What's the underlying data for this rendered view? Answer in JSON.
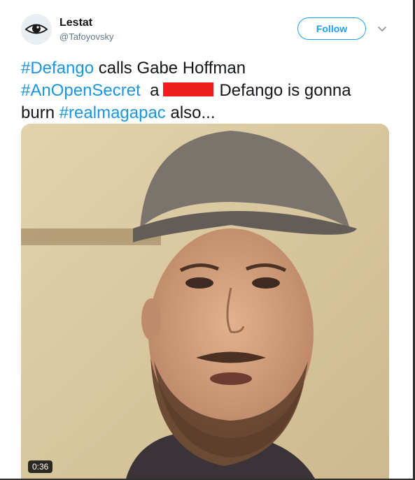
{
  "user": {
    "display_name": "Lestat",
    "handle": "@Tafoyovsky",
    "avatar_icon": "eye-icon"
  },
  "actions": {
    "follow_label": "Follow",
    "more_icon": "chevron-down-icon"
  },
  "tweet": {
    "hashtag_1": "#Defango",
    "text_1": " calls Gabe Hoffman",
    "hashtag_2": "#AnOpenSecret",
    "text_2a": "  a",
    "text_2b": "Defango is gonna",
    "text_3a": "burn ",
    "hashtag_3": "#realmagapac",
    "text_3b": " also..."
  },
  "video": {
    "duration": "0:36"
  },
  "colors": {
    "accent": "#1da1f2",
    "hashtag": "#1b95e0",
    "redaction": "#ef1e1e"
  }
}
